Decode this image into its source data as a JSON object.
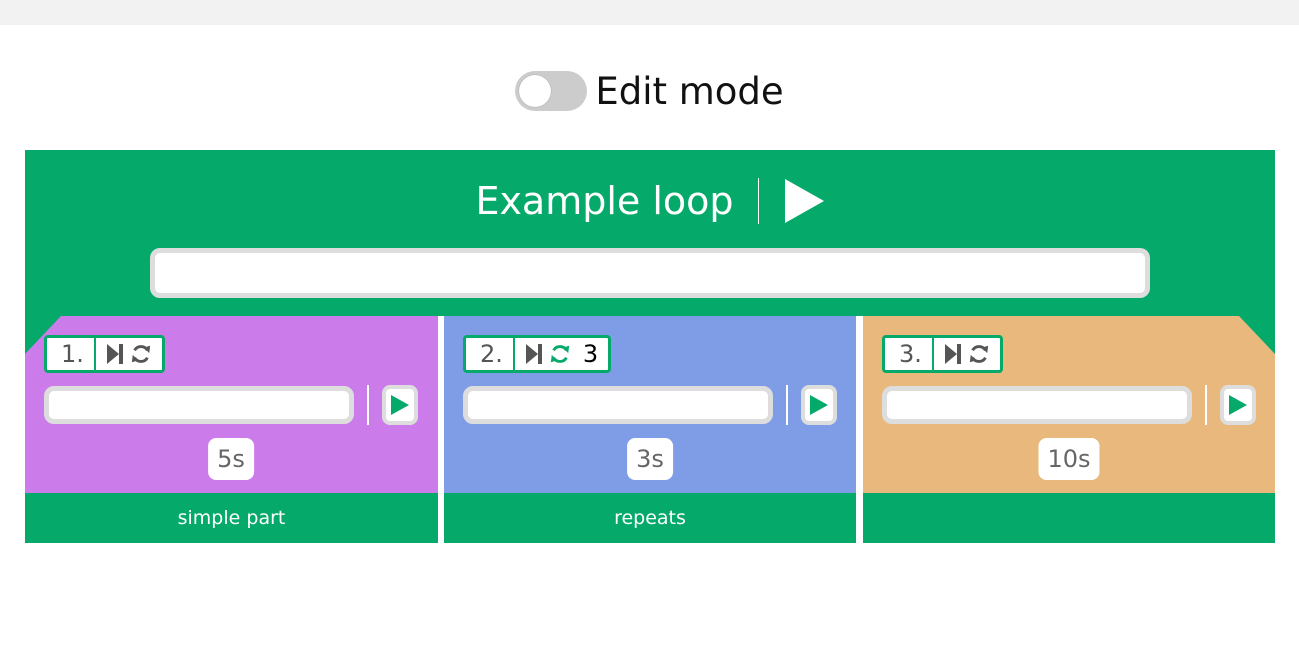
{
  "edit_mode": {
    "label": "Edit mode",
    "enabled": false
  },
  "loop": {
    "title": "Example loop",
    "input_value": "",
    "color": "#05aa6b"
  },
  "parts": [
    {
      "number": "1.",
      "repeat_count": "",
      "repeat_active": false,
      "duration": "5s",
      "input_value": "",
      "footer": "simple part",
      "color": "#cc7bea"
    },
    {
      "number": "2.",
      "repeat_count": "3",
      "repeat_active": true,
      "duration": "3s",
      "input_value": "",
      "footer": "repeats",
      "color": "#7f9ce6"
    },
    {
      "number": "3.",
      "repeat_count": "",
      "repeat_active": false,
      "duration": "10s",
      "input_value": "",
      "footer": "",
      "color": "#e8b87c"
    }
  ],
  "icons": {
    "play": "play-icon",
    "skip": "skip-to-end-icon",
    "repeat": "repeat-icon"
  }
}
